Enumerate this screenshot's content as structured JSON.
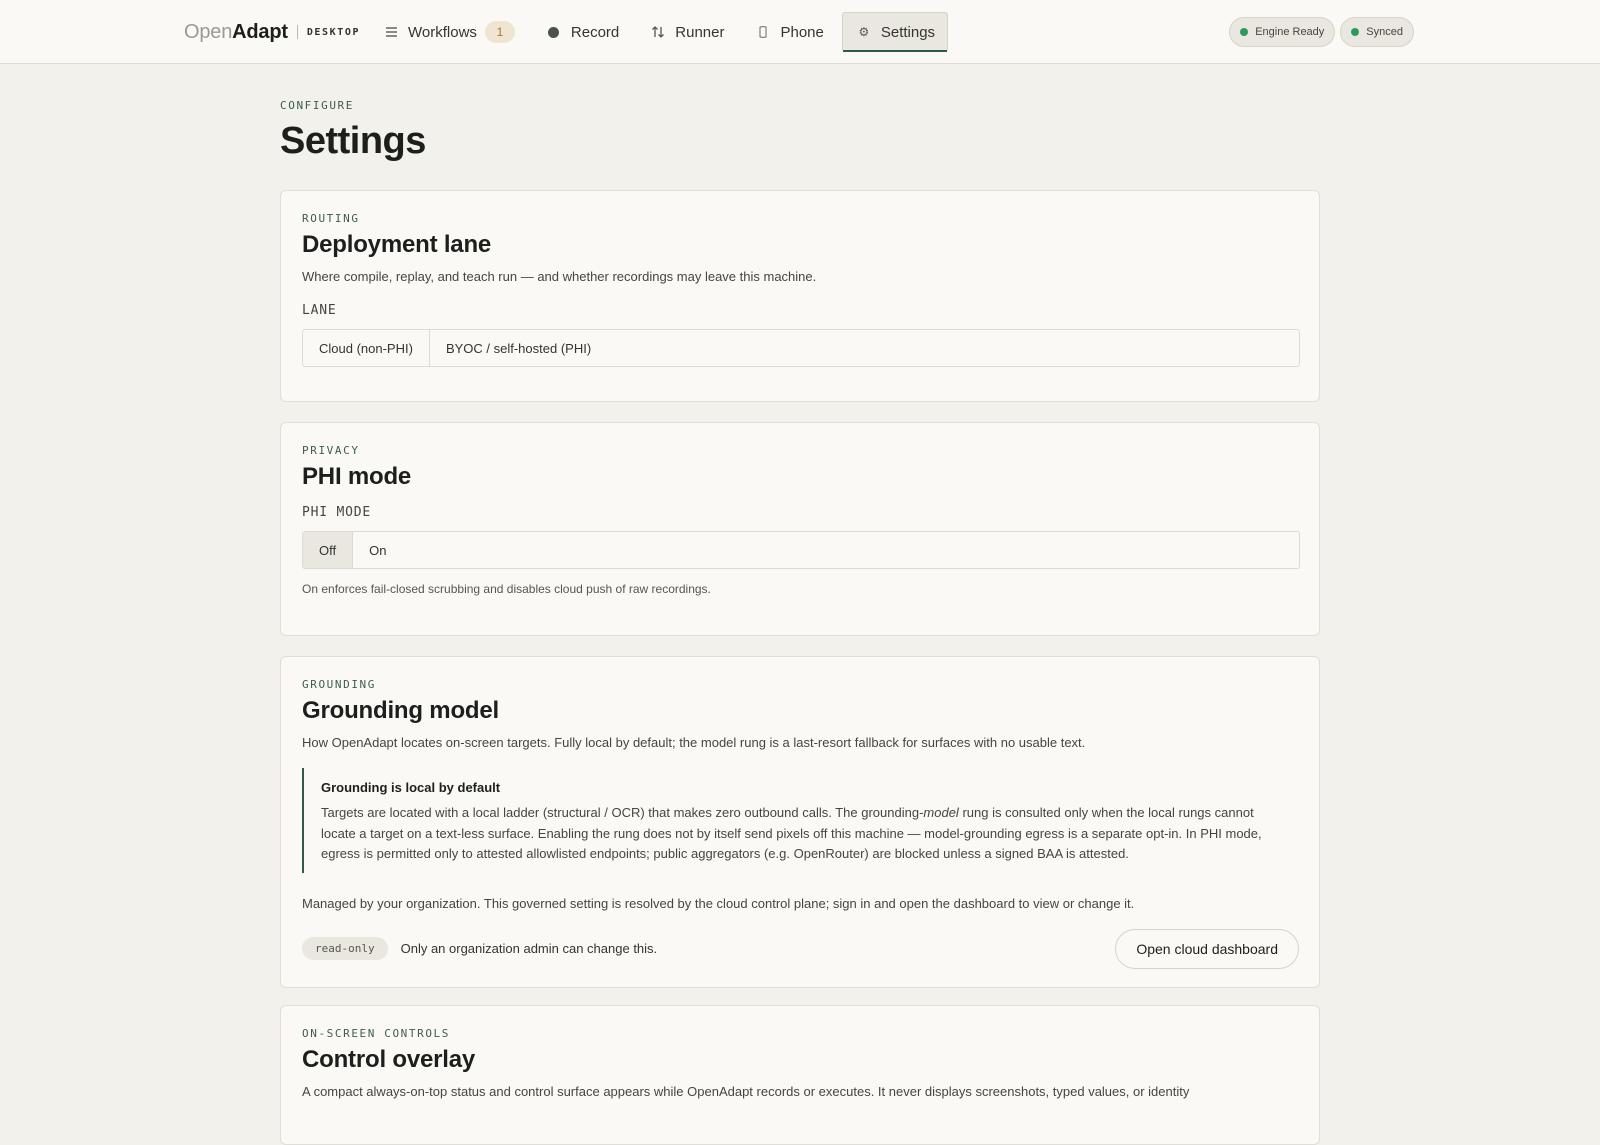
{
  "brand": {
    "open": "Open",
    "adapt": "Adapt",
    "tag": "DESKTOP"
  },
  "nav": {
    "workflows": {
      "label": "Workflows",
      "count": "1"
    },
    "record": {
      "label": "Record"
    },
    "runner": {
      "label": "Runner"
    },
    "phone": {
      "label": "Phone"
    },
    "settings": {
      "label": "Settings"
    }
  },
  "status": {
    "engine": "Engine Ready",
    "sync": "Synced"
  },
  "page": {
    "eyebrow": "CONFIGURE",
    "title": "Settings"
  },
  "routing": {
    "eyebrow": "ROUTING",
    "title": "Deployment lane",
    "desc": "Where compile, replay, and teach run — and whether recordings may leave this machine.",
    "field_label": "LANE",
    "options": [
      "Cloud (non-PHI)",
      "BYOC / self-hosted (PHI)"
    ]
  },
  "privacy": {
    "eyebrow": "PRIVACY",
    "title": "PHI mode",
    "field_label": "PHI MODE",
    "options": [
      "Off",
      "On"
    ],
    "selected": "Off",
    "help": "On enforces fail-closed scrubbing and disables cloud push of raw recordings."
  },
  "grounding": {
    "eyebrow": "GROUNDING",
    "title": "Grounding model",
    "desc": "How OpenAdapt locates on-screen targets. Fully local by default; the model rung is a last-resort fallback for surfaces with no usable text.",
    "callout_title": "Grounding is local by default",
    "callout_a": "Targets are located with a local ladder (structural / OCR) that makes zero outbound calls. The grounding-",
    "callout_em": "model",
    "callout_b": " rung is consulted only when the local rungs cannot locate a target on a text-less surface. Enabling the rung does not by itself send pixels off this machine — model-grounding egress is a separate opt-in. In PHI mode, egress is permitted only to attested allowlisted endpoints; public aggregators (e.g. OpenRouter) are blocked unless a signed BAA is attested.",
    "managed": "Managed by your organization. This governed setting is resolved by the cloud control plane; sign in and open the dashboard to view or change it.",
    "readonly_badge": "read-only",
    "readonly_text": "Only an organization admin can change this.",
    "dashboard_button": "Open cloud dashboard"
  },
  "overlay": {
    "eyebrow": "ON-SCREEN CONTROLS",
    "title": "Control overlay",
    "desc": "A compact always-on-top status and control surface appears while OpenAdapt records or executes. It never displays screenshots, typed values, or identity"
  },
  "colors": {
    "accent": "#2f5a45",
    "status_ok": "#2e9a5a",
    "badge": "#efe5d2",
    "background": "#f2f1ec",
    "card": "#faf9f5"
  }
}
